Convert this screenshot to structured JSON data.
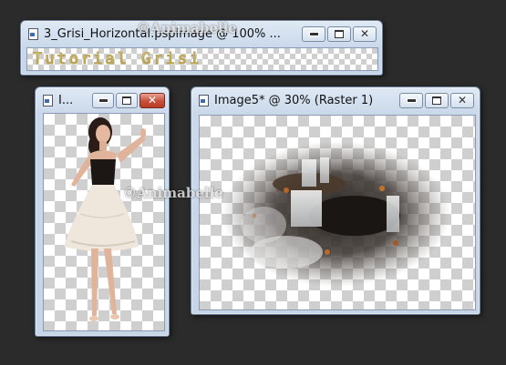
{
  "windows": {
    "banner": {
      "title": "3_Grisi_Horizontal.pspimage @ 100% ...",
      "content_text": "Tutorial Grisi"
    },
    "woman": {
      "title": "I..."
    },
    "image5": {
      "title": "Image5* @  30% (Raster 1)"
    }
  },
  "watermark": "©Animabelle",
  "icons": {
    "minimize": "minimize-icon",
    "maximize": "maximize-icon",
    "close": "close-icon",
    "document": "document-icon"
  },
  "colors": {
    "background": "#2b2b2b",
    "titlebar": "#c9d8ea",
    "close_button": "#c7503b",
    "banner_gold": "#c9a93f"
  }
}
